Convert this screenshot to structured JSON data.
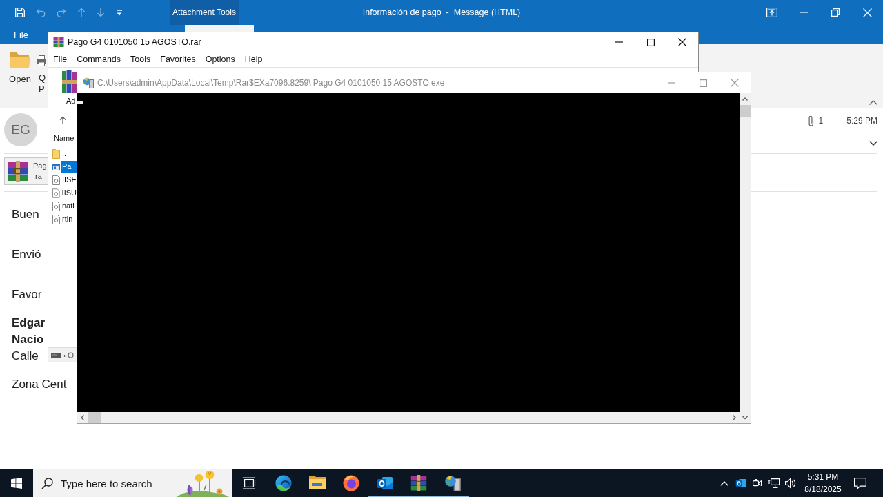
{
  "outlook": {
    "quick_access": [
      {
        "kind": "save",
        "disabled": false
      },
      {
        "kind": "undo",
        "disabled": true
      },
      {
        "kind": "redo",
        "disabled": true
      },
      {
        "kind": "up",
        "disabled": true
      },
      {
        "kind": "down",
        "disabled": true
      },
      {
        "kind": "customize",
        "disabled": false
      }
    ],
    "context_tab": {
      "label": "Attachment Tools",
      "selected": true
    },
    "title": "Información de pago  -  Message (HTML)",
    "ribbon_tabs": [
      {
        "label": "File",
        "selected": false
      }
    ],
    "ribbon_buttons": [
      {
        "kind": "open",
        "lines": [
          "Open"
        ]
      },
      {
        "kind": "print",
        "lines": [
          "Q",
          "P"
        ]
      }
    ],
    "sender_initials": "EG",
    "attachment_count": "1",
    "time": "5:29 PM",
    "attachment": {
      "name": "Pag",
      "extension": ".ra"
    },
    "body": [
      {
        "lines": [
          {
            "text": "Buen",
            "bold": false
          }
        ]
      },
      {
        "lines": [
          {
            "text": "Envió",
            "bold": false
          }
        ]
      },
      {
        "lines": [
          {
            "text": "Favor",
            "bold": false
          }
        ]
      },
      {
        "lines": [
          {
            "text": "Edgar",
            "bold": true
          },
          {
            "text": "Nacio",
            "bold": true
          },
          {
            "text": "Calle",
            "bold": false
          }
        ]
      },
      {
        "lines": [
          {
            "text": "Zona Cent",
            "bold": false
          }
        ]
      }
    ]
  },
  "winrar": {
    "title": "Pago G4 0101050 15 AGOSTO.rar",
    "menu": [
      "File",
      "Commands",
      "Tools",
      "Favorites",
      "Options",
      "Help"
    ],
    "toolbar": [
      "Ad"
    ],
    "columns": [
      "Name"
    ],
    "files": [
      {
        "name": "..",
        "kind": "parent",
        "selected": false
      },
      {
        "name": "Pa",
        "kind": "program",
        "selected": true
      },
      {
        "name": "IISE",
        "kind": "file",
        "selected": false
      },
      {
        "name": "IISU",
        "kind": "file",
        "selected": false
      },
      {
        "name": "nati",
        "kind": "file",
        "selected": false
      },
      {
        "name": "rtin",
        "kind": "file",
        "selected": false
      }
    ]
  },
  "console": {
    "title": "C:\\Users\\admin\\AppData\\Local\\Temp\\Rar$EXa7096.8259\\ Pago G4 0101050 15 AGOSTO.exe"
  },
  "taskbar": {
    "search": {
      "placeholder": "Type here to search"
    },
    "apps": [
      {
        "kind": "edge",
        "running": false
      },
      {
        "kind": "explorer",
        "running": false
      },
      {
        "kind": "firefox",
        "running": false
      },
      {
        "kind": "outlook",
        "running": true
      },
      {
        "kind": "winrar",
        "running": true
      },
      {
        "kind": "console",
        "running": true
      }
    ],
    "time": "5:31 PM",
    "date": "8/18/2025"
  }
}
